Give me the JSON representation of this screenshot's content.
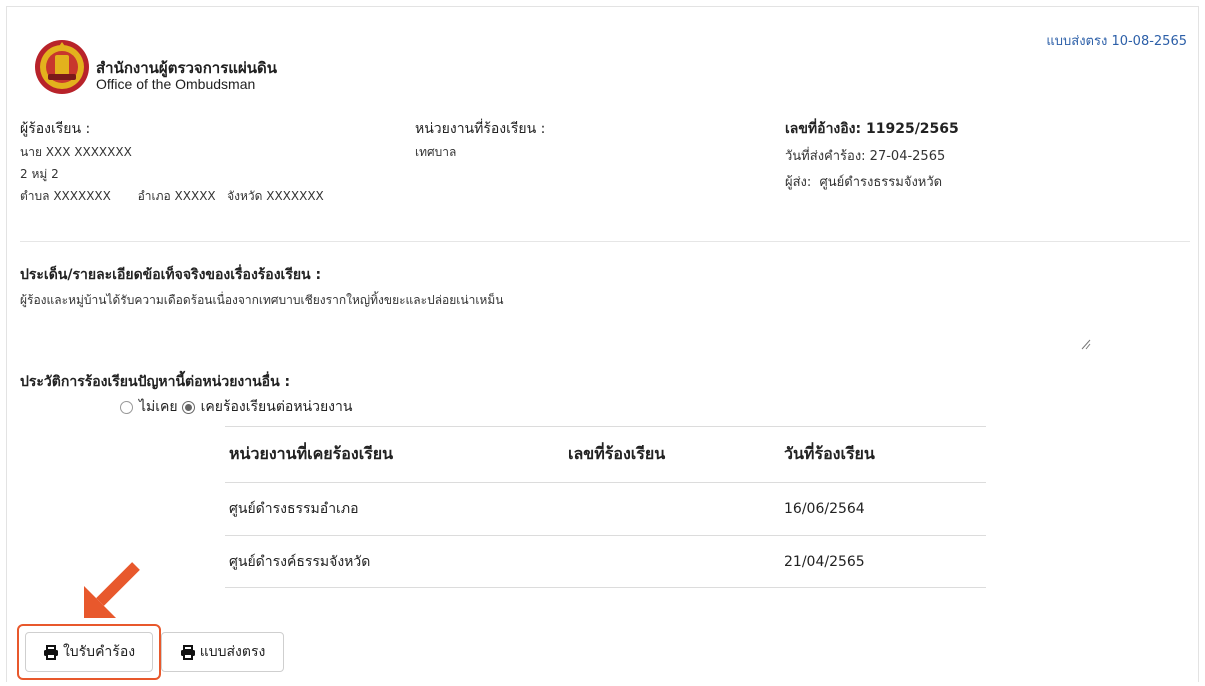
{
  "header": {
    "org_name_th": "สำนักงานผู้ตรวจการแผ่นดิน",
    "org_name_en": "Office of the Ombudsman",
    "form_type_date": "แบบส่งตรง 10-08-2565"
  },
  "complainant": {
    "label": "ผู้ร้องเรียน :",
    "name": "นาย XXX   XXXXXXX",
    "address_line": "2 หมู่ 2",
    "locality": "ตำบล XXXXXXX       อำเภอ XXXXX   จังหวัด XXXXXXX"
  },
  "agency": {
    "label": "หน่วยงานที่ร้องเรียน :",
    "value": "เทศบาล"
  },
  "reference": {
    "ref_no": "เลขที่อ้างอิง: 11925/2565",
    "sent_date": "วันที่ส่งคำร้อง: 27-04-2565",
    "sender": "ผู้ส่ง:  ศูนย์ดำรงธรรมจังหวัด"
  },
  "details": {
    "label": "ประเด็น/รายละเอียดข้อเท็จจริงของเรื่องร้องเรียน :",
    "text": "ผู้ร้องและหมู่บ้านได้รับความเดือดร้อนเนื่องจากเทศบาบเชียงรากใหญ่ทิ้งขยะและปล่อยเน่าเหม็น"
  },
  "history": {
    "label": "ประวัติการร้องเรียนปัญหานี้ต่อหน่วยงานอื่น :",
    "option_never": "ไม่เคย",
    "option_ever": "เคยร้องเรียนต่อหน่วยงาน",
    "selected": "ever",
    "columns": [
      "หน่วยงานที่เคยร้องเรียน",
      "เลขที่ร้องเรียน",
      "วันที่ร้องเรียน"
    ],
    "rows": [
      [
        "ศูนย์ดำรงธรรมอำเภอ",
        "",
        "16/06/2564"
      ],
      [
        "ศูนย์ดำรงค์ธรรมจังหวัด",
        "",
        "21/04/2565"
      ]
    ]
  },
  "actions": {
    "receipt_label": "ใบรับคำร้อง",
    "direct_label": "แบบส่งตรง"
  },
  "colors": {
    "highlight": "#e8582c",
    "link": "#2c5fa8"
  }
}
